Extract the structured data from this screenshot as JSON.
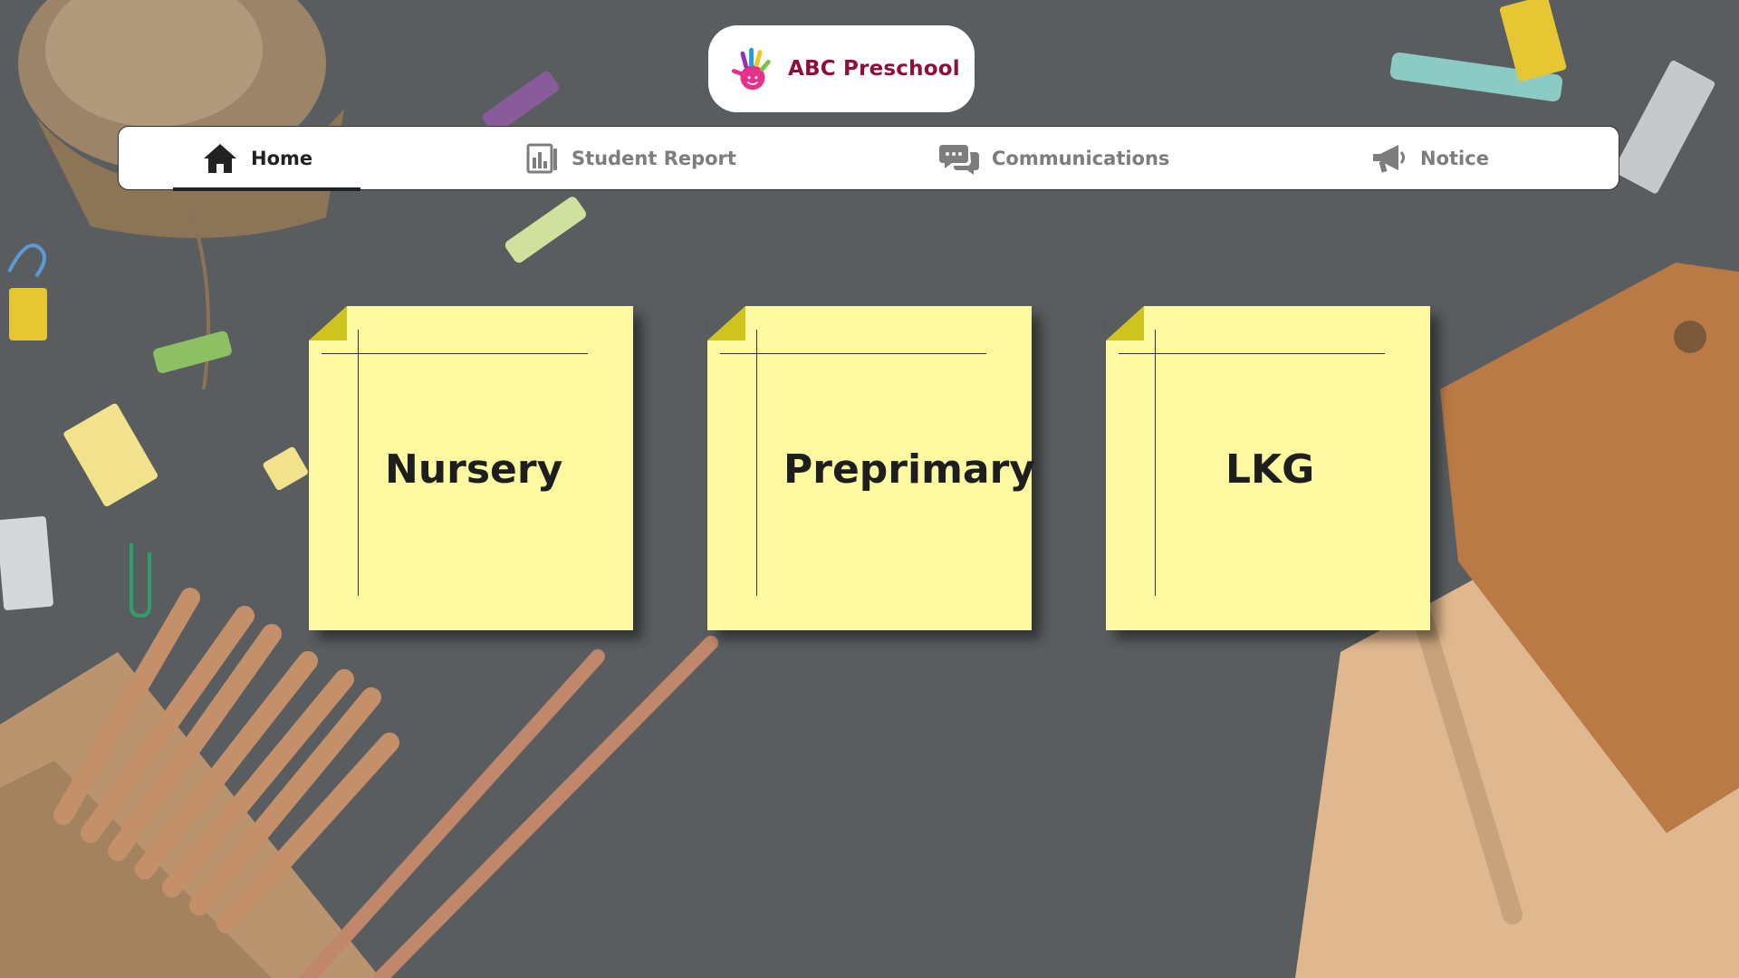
{
  "brand": {
    "name": "ABC Preschool",
    "logo_icon": "hand-print-icon",
    "color": "#8e1038"
  },
  "nav": {
    "items": [
      {
        "label": "Home",
        "icon": "home-icon",
        "active": true
      },
      {
        "label": "Student Report",
        "icon": "report-icon",
        "active": false
      },
      {
        "label": "Communications",
        "icon": "chat-bubbles-icon",
        "active": false
      },
      {
        "label": "Notice",
        "icon": "megaphone-icon",
        "active": false
      }
    ]
  },
  "classes": [
    {
      "label": "Nursery"
    },
    {
      "label": "Preprimary"
    },
    {
      "label": "LKG"
    }
  ],
  "colors": {
    "background": "#5a5d5f",
    "note": "#fdf9a1",
    "note_fold": "#cfc41e"
  }
}
